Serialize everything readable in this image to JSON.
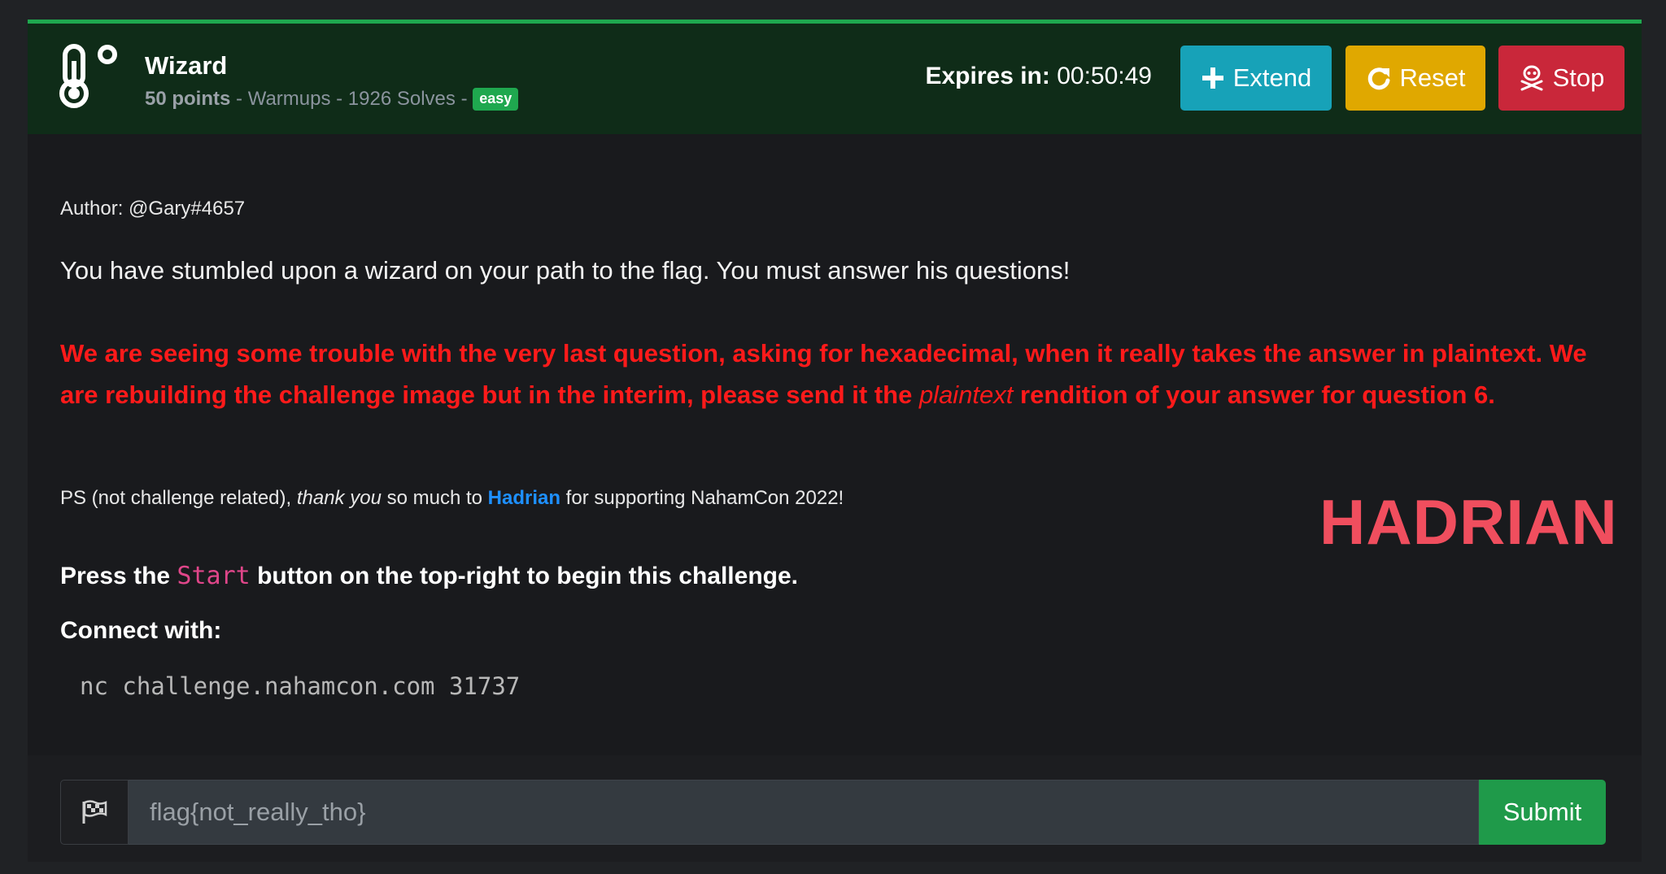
{
  "challenge": {
    "title": "Wizard",
    "points": "50 points",
    "meta_rest": " - Warmups - 1926 Solves - ",
    "difficulty": "easy",
    "icon": "thermometer-icon"
  },
  "timer": {
    "label": "Expires in:",
    "value": " 00:50:49"
  },
  "buttons": {
    "extend": "Extend",
    "reset": "Reset",
    "stop": "Stop"
  },
  "colors": {
    "accent_green": "#1fa84f",
    "extend": "#17a2b8",
    "reset": "#e0a800",
    "stop": "#c9273a",
    "warning": "#ff1a1a",
    "link": "#1e90ff"
  },
  "body": {
    "author": "Author: @Gary#4657",
    "description": "You have stumbled upon a wizard on your path to the flag. You must answer his questions!",
    "warning_before": "We are seeing some trouble with the very last question, asking for hexadecimal, when it really takes the answer in plaintext. We are rebuilding the challenge image but in the interim, please send it the ",
    "warning_em": "plaintext",
    "warning_after": " rendition of your answer for question 6.",
    "ps_before": "PS (not challenge related), ",
    "ps_em": "thank you",
    "ps_mid": " so much to ",
    "ps_link": "Hadrian",
    "ps_after": " for supporting NahamCon 2022!",
    "press_before": "Press the ",
    "press_code": "Start",
    "press_after": " button on the top-right to begin this challenge.",
    "connect_label": "Connect with:",
    "command": "nc challenge.nahamcon.com 31737",
    "logo_text": "HADRIAN"
  },
  "flag_form": {
    "placeholder": "flag{not_really_tho}",
    "submit": "Submit"
  }
}
